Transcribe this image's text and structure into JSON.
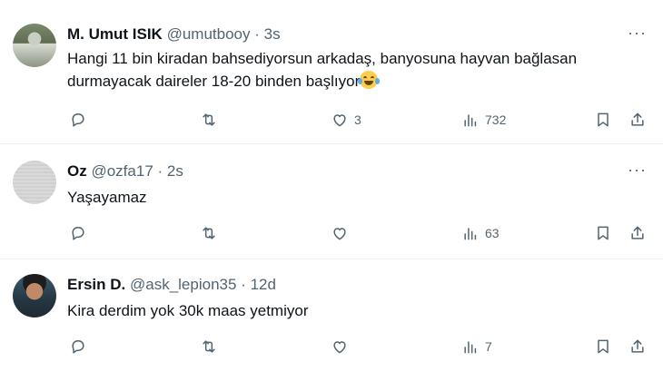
{
  "tweets": [
    {
      "name": "M. Umut ISIK",
      "handle": "@umutbooy",
      "separator": "·",
      "time": "3s",
      "text_line1": "Hangi 11 bin kiradan bahsediyorsun arkadaş, banyosuna hayvan bağlasan",
      "text_line2": "durmayacak daireler 18-20 binden başlıyor",
      "emoji": "face-with-tears-of-joy",
      "likes": "3",
      "views": "732"
    },
    {
      "name": "Oz",
      "handle": "@ozfa17",
      "separator": "·",
      "time": "2s",
      "text_line1": "Yaşayamaz",
      "likes": "",
      "views": "63"
    },
    {
      "name": "Ersin D.",
      "handle": "@ask_lepion35",
      "separator": "·",
      "time": "12d",
      "text_line1": "Kira derdim yok 30k maas yetmiyor",
      "likes": "",
      "views": "7"
    }
  ],
  "more_label": "···",
  "icons": [
    "reply-icon",
    "retweet-icon",
    "like-icon",
    "views-icon",
    "bookmark-icon",
    "share-icon",
    "more-icon"
  ],
  "colors": {
    "text": "#0f1419",
    "secondary": "#536471",
    "divider": "#eff3f4"
  }
}
